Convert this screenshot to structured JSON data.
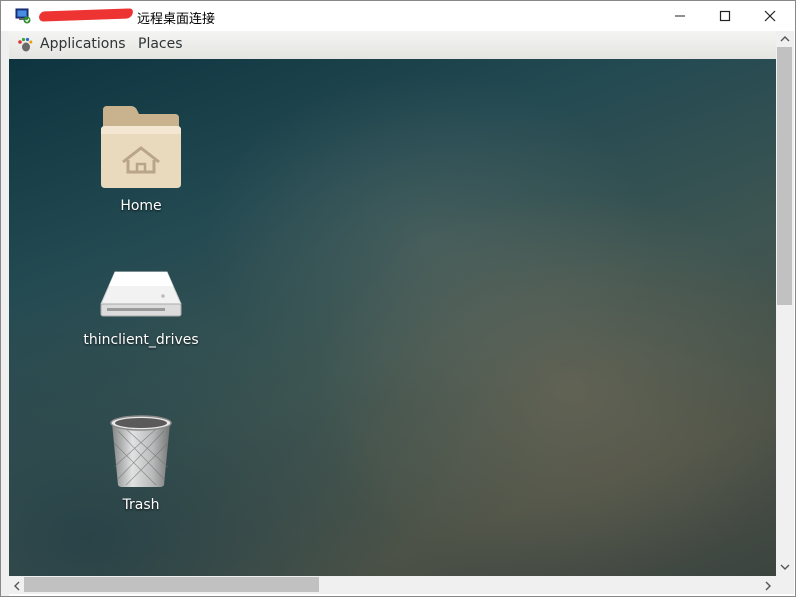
{
  "window": {
    "title": "远程桌面连接",
    "icon": "remote-desktop-icon",
    "controls": {
      "minimize": "minimize-icon",
      "maximize": "maximize-icon",
      "close": "close-icon"
    }
  },
  "panel": {
    "applications_label": "Applications",
    "places_label": "Places",
    "applications_icon": "gnome-foot-icon"
  },
  "desktop": {
    "icons": [
      {
        "label": "Home",
        "icon": "home-folder-icon"
      },
      {
        "label": "thinclient_drives",
        "icon": "drive-icon"
      },
      {
        "label": "Trash",
        "icon": "trash-icon"
      }
    ]
  },
  "scrollbars": {
    "vertical_position_fraction": 0.0,
    "horizontal_position_fraction": 0.0
  }
}
